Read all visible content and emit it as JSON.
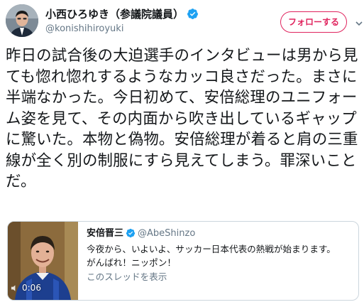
{
  "author": {
    "display_name": "小西ひろゆき（参議院議員）",
    "handle": "@konishihiroyuki",
    "verified_icon": "verified-badge"
  },
  "follow_button": {
    "label": "フォローする",
    "color": "#e0245e"
  },
  "tweet": {
    "text": "昨日の試合後の大迫選手のインタビューは男から見ても惚れ惚れするようなカッコ良さだった。まさに半端なかった。今日初めて、安倍総理のユニフォーム姿を見て、その内面から吹き出しているギャップに驚いた。本物と偽物。安倍総理が着ると肩の三重線が全く別の制服にすら見えてしまう。罪深いことだ。"
  },
  "quoted_tweet": {
    "display_name": "安倍晋三",
    "handle": "@AbeShinzo",
    "text_line1": "今夜から、いよいよ、サッカー日本代表の熱戦が始まります。",
    "text_line2": "がんばれ！ニッポン！",
    "thread_link": "このスレッドを表示",
    "video_duration": "0:06"
  },
  "colors": {
    "verified_blue": "#1da1f2",
    "text_primary": "#14171a",
    "text_secondary": "#657786",
    "border": "#ccd6dd"
  }
}
